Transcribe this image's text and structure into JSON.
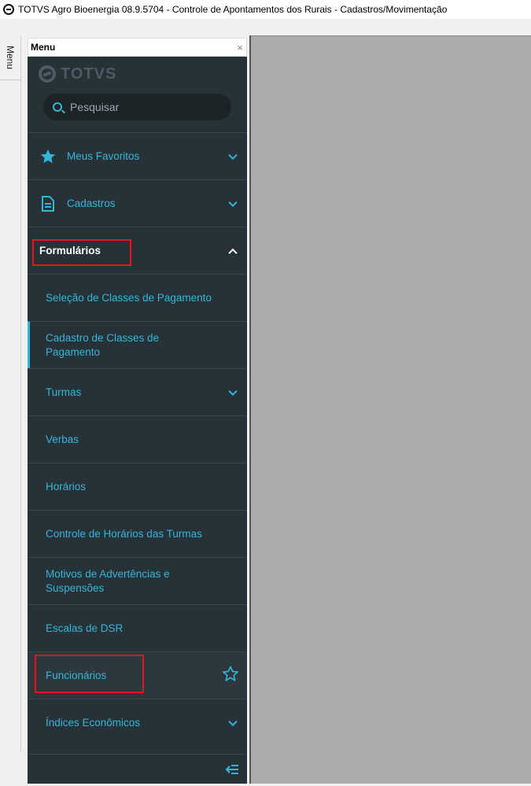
{
  "window": {
    "title": "TOTVS Agro Bioenergia 08.9.5704 - Controle de Apontamentos dos Rurais - Cadastros/Movimentação"
  },
  "side_tab": {
    "label": "Menu"
  },
  "menu": {
    "header_label": "Menu",
    "close_glyph": "×",
    "logo_text": "TOTVS",
    "search": {
      "placeholder": "Pesquisar",
      "value": ""
    },
    "groups": [
      {
        "label": "Meus Favoritos",
        "icon": "star-icon",
        "expanded": false
      },
      {
        "label": "Cadastros",
        "icon": "document-icon",
        "expanded": false
      },
      {
        "label": "Formulários",
        "expanded": true,
        "highlighted": true
      }
    ],
    "items": [
      {
        "label": "Seleção de Classes de Pagamento"
      },
      {
        "label": "Cadastro de Classes de Pagamento",
        "selected": true
      },
      {
        "label": "Turmas",
        "has_children": true
      },
      {
        "label": "Verbas"
      },
      {
        "label": "Horários"
      },
      {
        "label": "Controle de Horários das Turmas"
      },
      {
        "label": "Motivos de Advertências e Suspensões"
      },
      {
        "label": "Escalas de DSR"
      },
      {
        "label": "Funcionários",
        "highlighted": true,
        "favorite_icon": "star-outline-icon"
      },
      {
        "label": "Índices Econômicos",
        "has_children": true
      }
    ],
    "footer_icon": "collapse-menu-icon"
  },
  "colors": {
    "menu_bg": "#263238",
    "accent": "#35b5d6",
    "highlight_box": "#e8141c",
    "content_bg": "#ababab"
  }
}
